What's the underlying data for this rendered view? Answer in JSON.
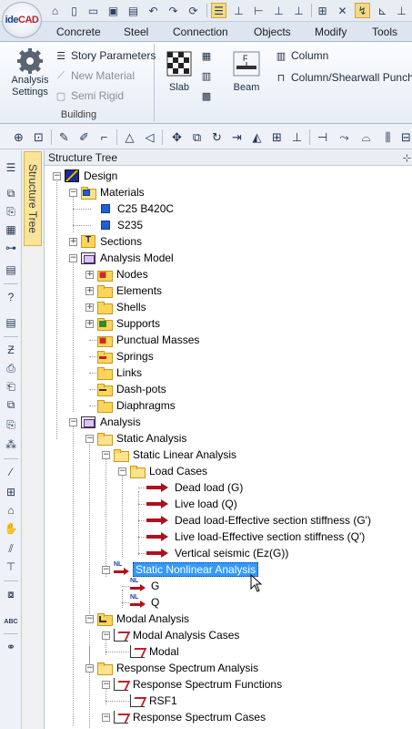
{
  "app": {
    "logo_text": "ideCAD",
    "logo_ide": "ide",
    "logo_cad": "CAD"
  },
  "quick_access": [
    "home-icon",
    "new-file-icon",
    "open-folder-icon",
    "save-icon",
    "save-as-icon",
    "undo-icon",
    "redo-icon",
    "refresh-icon",
    "print-icon",
    "layers-icon",
    "snap-icon",
    "ortho-icon",
    "grid-icon",
    "polar-icon",
    "osnap-icon",
    "axis-icon",
    "dimension-icon"
  ],
  "tabs": [
    "Concrete",
    "Steel",
    "Connection",
    "Objects",
    "Modify",
    "Tools"
  ],
  "ribbon": {
    "building_group": {
      "label": "Building",
      "analysis_settings": "Analysis\nSettings",
      "story_parameters": "Story Parameters",
      "new_material": "New Material",
      "semi_rigid": "Semi Rigid"
    },
    "objects_group": {
      "slab": "Slab",
      "beam": "Beam",
      "column": "Column",
      "column_punching": "Column/Shearwall Punching"
    }
  },
  "sidebar_tab": "Structure Tree",
  "panel": {
    "title": "Structure Tree",
    "pin": "⊹"
  },
  "tree": {
    "design": "Design",
    "materials": "Materials",
    "mat1": "C25 B420C",
    "mat2": "S235",
    "sections": "Sections",
    "analysis_model": "Analysis Model",
    "nodes": "Nodes",
    "elements": "Elements",
    "shells": "Shells",
    "supports": "Supports",
    "punctual_masses": "Punctual Masses",
    "springs": "Springs",
    "links": "Links",
    "dashpots": "Dash-pots",
    "diaphragms": "Diaphragms",
    "analysis": "Analysis",
    "static_analysis": "Static Analysis",
    "static_linear": "Static Linear Analysis",
    "load_cases": "Load Cases",
    "lc1": "Dead load (G)",
    "lc2": "Live load (Q)",
    "lc3": "Dead load-Effective section stiffness (G')",
    "lc4": "Live load-Effective section stiffness (Q')",
    "lc5": "Vertical seismic (Ez(G))",
    "static_nonlinear": "Static Nonlinear Analysis",
    "nl1": "G",
    "nl2": "Q",
    "nl_badge": "NL",
    "modal_analysis": "Modal Analysis",
    "modal_cases": "Modal Analysis Cases",
    "modal": "Modal",
    "rs_analysis": "Response Spectrum Analysis",
    "rs_functions": "Response Spectrum Functions",
    "rsf1": "RSF1",
    "rs_cases": "Response Spectrum Cases"
  },
  "expanders": {
    "collapsed": "+",
    "expanded": "−"
  },
  "colors": {
    "selection": "#3399ff",
    "arrow": "#b0101a",
    "folder": "#ffd458",
    "material": "#1f5fd8"
  }
}
